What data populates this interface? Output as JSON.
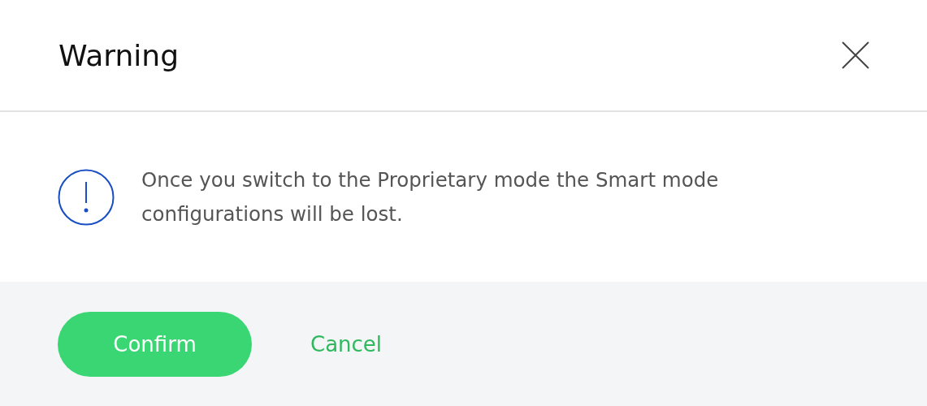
{
  "dialog": {
    "title": "Warning",
    "message": "Once you switch to the Proprietary mode the Smart mode configurations will be lost.",
    "buttons": [
      {
        "kind": "primary",
        "label": "Confirm"
      },
      {
        "kind": "link",
        "label": "Cancel"
      }
    ]
  }
}
